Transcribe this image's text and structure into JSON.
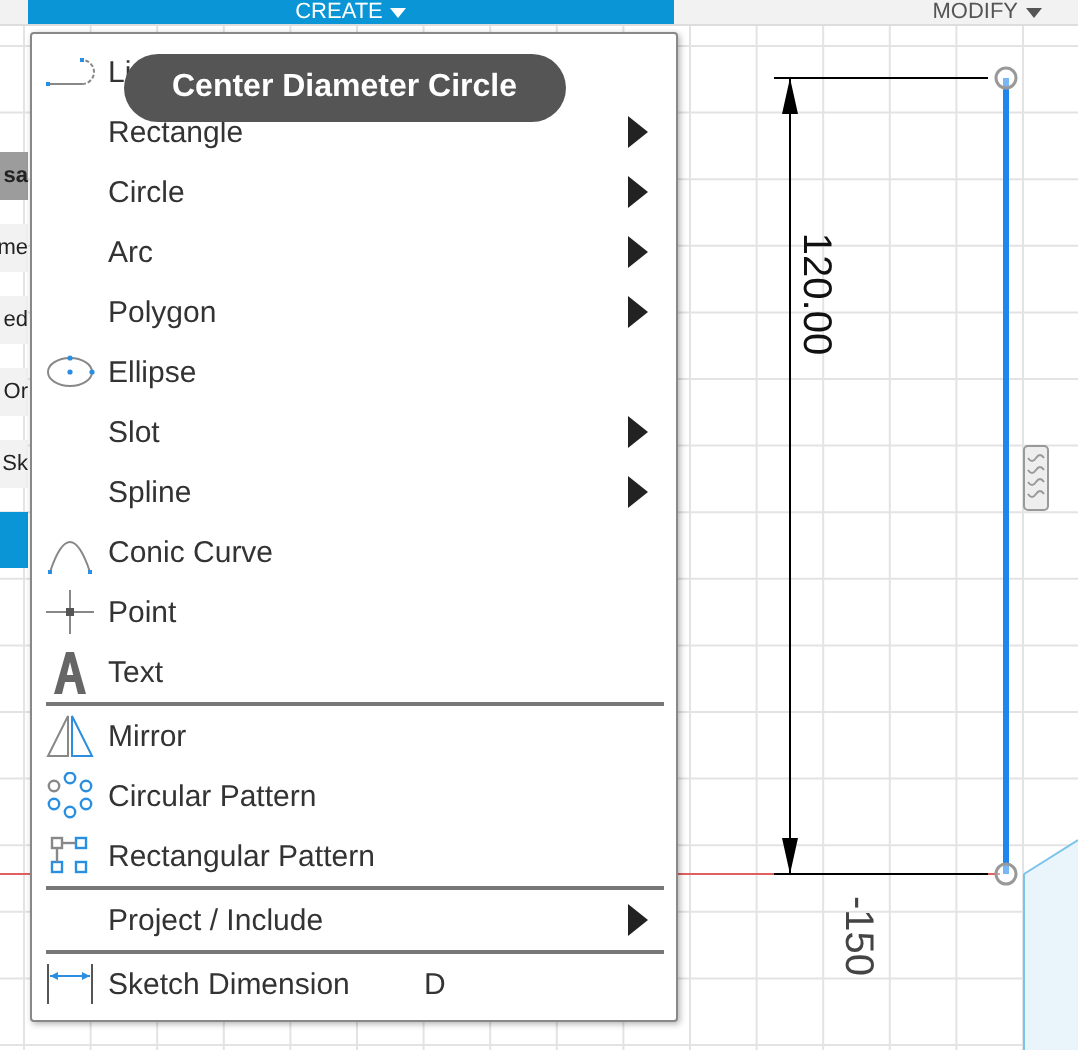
{
  "toolbar": {
    "tabs": [
      {
        "label": "CREATE",
        "selected": true
      },
      {
        "label": "MODIFY",
        "selected": false
      }
    ]
  },
  "side_panel": {
    "rows": [
      {
        "text": "sa",
        "kind": "header"
      },
      {
        "text": "me",
        "kind": "row"
      },
      {
        "text": "ed",
        "kind": "row"
      },
      {
        "text": "Or",
        "kind": "row"
      },
      {
        "text": "Sk",
        "kind": "row"
      },
      {
        "text": "",
        "kind": "selected"
      }
    ]
  },
  "menu": {
    "sections": [
      [
        {
          "label": "Li",
          "submenu": false
        },
        {
          "label": "Rectangle",
          "submenu": true
        },
        {
          "label": "Circle",
          "submenu": true
        },
        {
          "label": "Arc",
          "submenu": true
        },
        {
          "label": "Polygon",
          "submenu": true
        },
        {
          "label": "Ellipse",
          "submenu": false
        },
        {
          "label": "Slot",
          "submenu": true
        },
        {
          "label": "Spline",
          "submenu": true
        },
        {
          "label": "Conic Curve",
          "submenu": false
        },
        {
          "label": "Point",
          "submenu": false
        },
        {
          "label": "Text",
          "submenu": false
        }
      ],
      [
        {
          "label": "Mirror",
          "submenu": false
        },
        {
          "label": "Circular Pattern",
          "submenu": false
        },
        {
          "label": "Rectangular Pattern",
          "submenu": false
        }
      ],
      [
        {
          "label": "Project / Include",
          "submenu": true
        }
      ],
      [
        {
          "label": "Sketch Dimension",
          "submenu": false,
          "shortcut": "D"
        }
      ]
    ]
  },
  "tooltip": "Center Diameter Circle",
  "canvas": {
    "dimension": "120.00",
    "ruler_label": "-150"
  }
}
